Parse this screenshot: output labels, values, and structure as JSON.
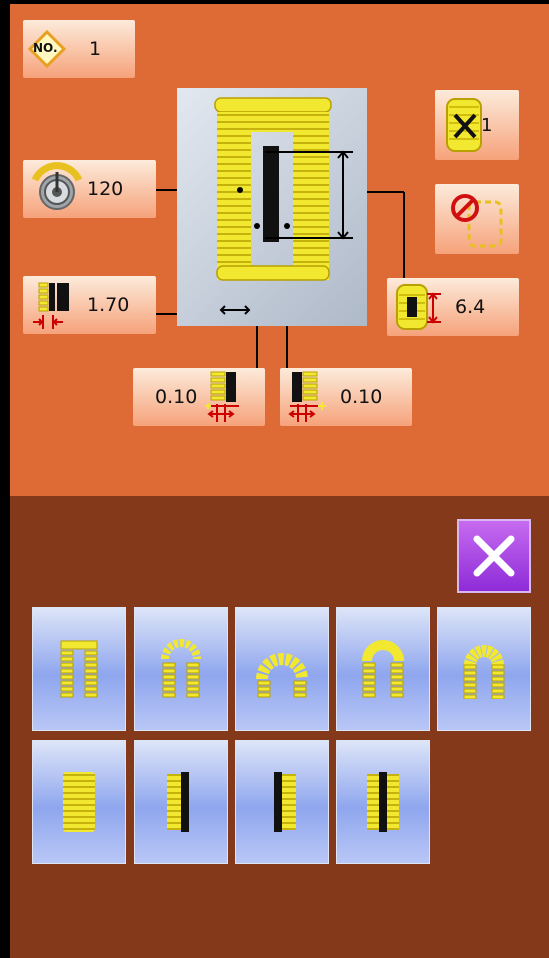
{
  "program": {
    "no_label": "NO.",
    "number": "1"
  },
  "params": {
    "speed": "120",
    "cut_space": "1.70",
    "repeat": "1",
    "length": "6.4",
    "left_width": "0.10",
    "right_width": "0.10"
  },
  "colors": {
    "panel": "#DE6B35",
    "bottom": "#84391A",
    "stitch": "#F2E830",
    "button": "#8FA6EE",
    "close": "#A848E4"
  },
  "icons": {
    "program_no": "diamond-icon",
    "speed": "gauge-icon",
    "cut_space": "cut-space-icon",
    "repeat": "repeat-count-icon",
    "disable": "prohibit-icon",
    "length": "length-icon",
    "left_width": "left-width-icon",
    "right_width": "right-width-icon",
    "close": "close-icon"
  },
  "patterns": [
    "square-bar-tack-pattern-icon",
    "round-bar-tack-pattern-icon",
    "radial-bar-tack-pattern-icon",
    "half-round-top-pattern-icon",
    "round-top-pattern-icon",
    "straight-bar-pattern-icon",
    "left-knife-bar-pattern-icon",
    "right-knife-bar-pattern-icon",
    "center-knife-bar-pattern-icon"
  ]
}
